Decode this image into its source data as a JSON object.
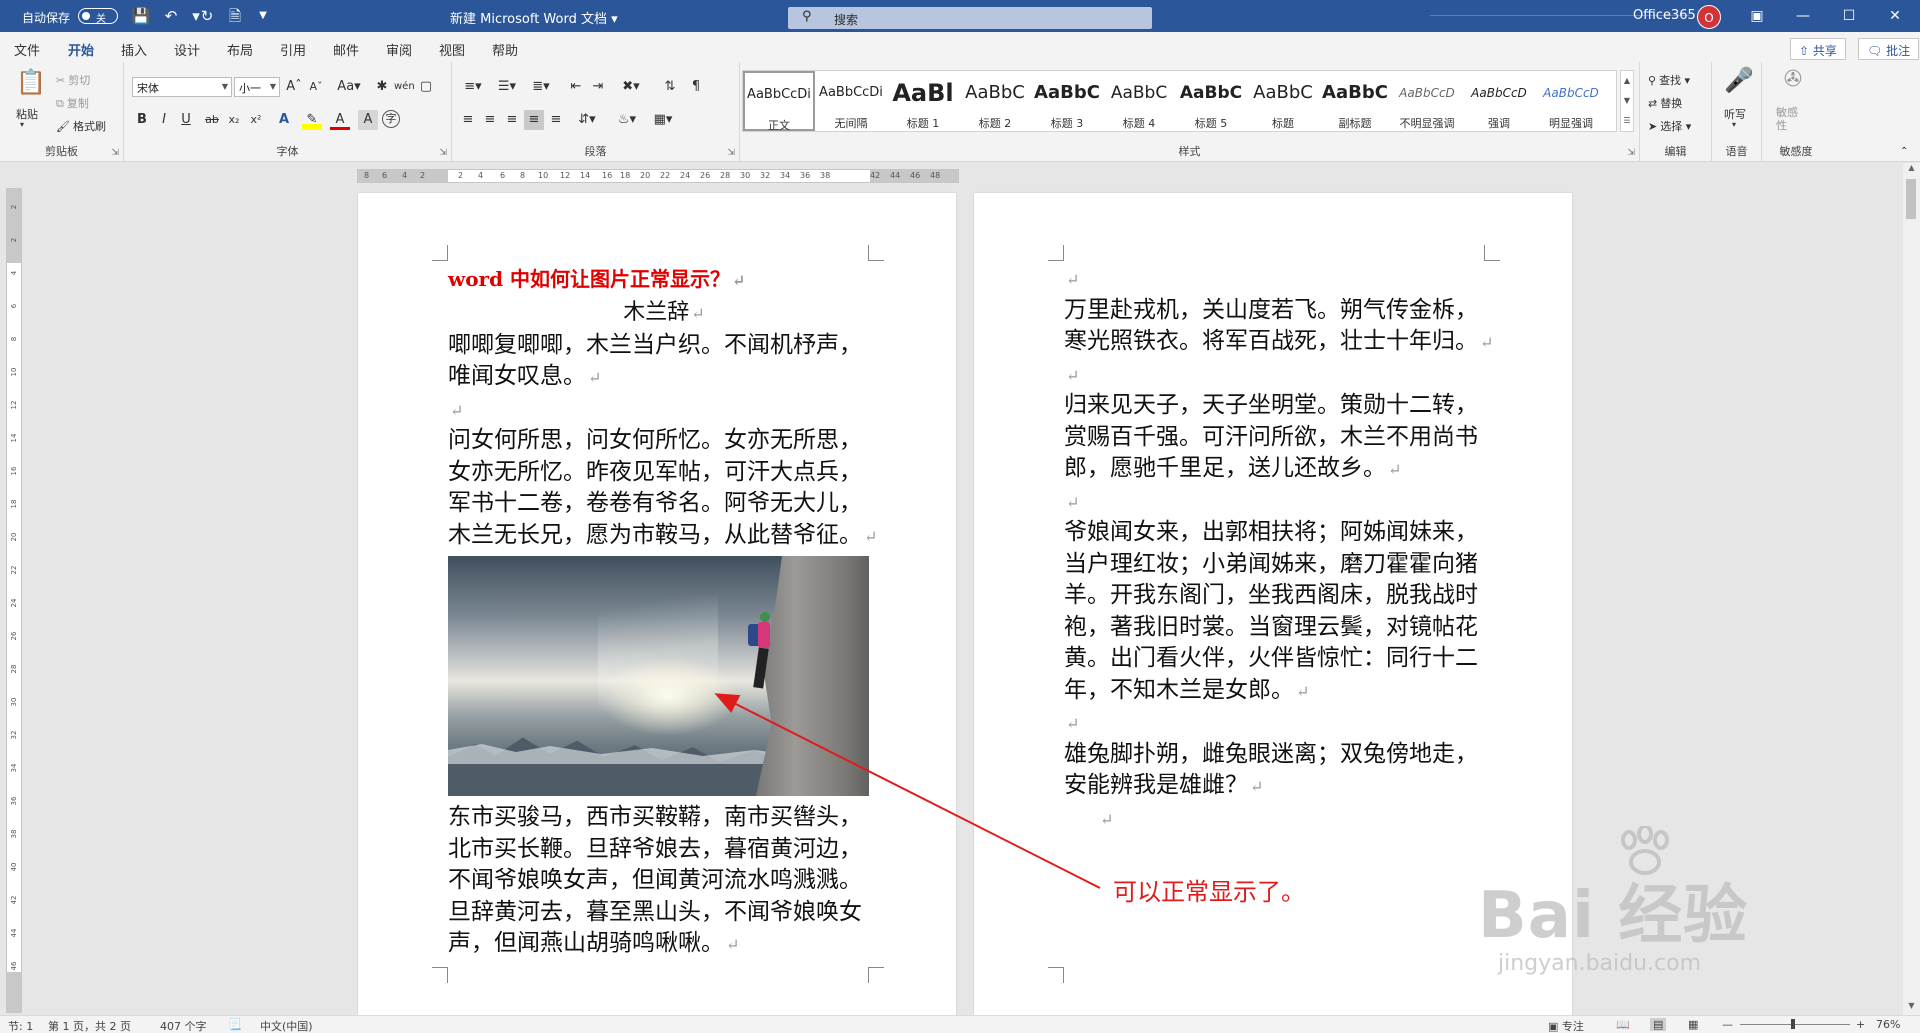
{
  "titlebar": {
    "autosave_label": "自动保存",
    "autosave_state": "关",
    "doc_title": "新建 Microsoft Word 文档",
    "search_placeholder": "搜索",
    "account": "Office365",
    "avatar_initial": "O"
  },
  "tabs": [
    "文件",
    "开始",
    "插入",
    "设计",
    "布局",
    "引用",
    "邮件",
    "审阅",
    "视图",
    "帮助"
  ],
  "active_tab": "开始",
  "share_label": "共享",
  "comment_label": "批注",
  "ribbon": {
    "clipboard": {
      "label": "剪贴板",
      "paste": "粘贴",
      "cut": "剪切",
      "copy": "复制",
      "format_painter": "格式刷"
    },
    "font": {
      "label": "字体",
      "font_name": "宋体",
      "font_size": "小一"
    },
    "paragraph": {
      "label": "段落"
    },
    "styles": {
      "label": "样式",
      "items": [
        {
          "sample": "AaBbCcDi",
          "name": "正文"
        },
        {
          "sample": "AaBbCcDi",
          "name": "无间隔"
        },
        {
          "sample": "AaBl",
          "name": "标题 1"
        },
        {
          "sample": "AaBbC",
          "name": "标题 2"
        },
        {
          "sample": "AaBbC",
          "name": "标题 3"
        },
        {
          "sample": "AaBbC",
          "name": "标题 4"
        },
        {
          "sample": "AaBbC",
          "name": "标题 5"
        },
        {
          "sample": "AaBbC",
          "name": "标题"
        },
        {
          "sample": "AaBbC",
          "name": "副标题"
        },
        {
          "sample": "AaBbCcD",
          "name": "不明显强调"
        },
        {
          "sample": "AaBbCcD",
          "name": "强调"
        },
        {
          "sample": "AaBbCcD",
          "name": "明显强调"
        }
      ]
    },
    "editing": {
      "label": "编辑",
      "find": "查找",
      "replace": "替换",
      "select": "选择"
    },
    "voice": {
      "label": "语音",
      "dictate": "听写"
    },
    "sensitivity": {
      "label": "敏感度",
      "button": "敏感性"
    }
  },
  "ruler_ticks": [
    "8",
    "6",
    "4",
    "2",
    "2",
    "4",
    "6",
    "8",
    "10",
    "12",
    "14",
    "16",
    "18",
    "20",
    "22",
    "24",
    "26",
    "28",
    "30",
    "32",
    "34",
    "36",
    "38",
    "42",
    "44",
    "46",
    "48"
  ],
  "vruler_ticks": [
    "2",
    "2",
    "4",
    "6",
    "8",
    "10",
    "12",
    "14",
    "16",
    "18",
    "20",
    "22",
    "24",
    "26",
    "28",
    "30",
    "32",
    "34",
    "36",
    "38",
    "40",
    "42",
    "44",
    "46"
  ],
  "page1": {
    "title": "word 中如何让图片正常显示？",
    "subtitle": "木兰辞",
    "para1": "唧唧复唧唧，木兰当户织。不闻机杼声，唯闻女叹息。",
    "para2": "问女何所思，问女何所忆。女亦无所思，女亦无所忆。昨夜见军帖，可汗大点兵，军书十二卷，卷卷有爷名。阿爷无大儿，木兰无长兄，愿为市鞍马，从此替爷征。",
    "para3": "东市买骏马，西市买鞍鞯，南市买辔头，北市买长鞭。旦辞爷娘去，暮宿黄河边，不闻爷娘唤女声，但闻黄河流水鸣溅溅。旦辞黄河去，暮至黑山头，不闻爷娘唤女声，但闻燕山胡骑鸣啾啾。"
  },
  "page2": {
    "para1": "万里赴戎机，关山度若飞。朔气传金柝，寒光照铁衣。将军百战死，壮士十年归。",
    "para2": "归来见天子，天子坐明堂。策勋十二转，赏赐百千强。可汗问所欲，木兰不用尚书郎，愿驰千里足，送儿还故乡。",
    "para3": "爷娘闻女来，出郭相扶将；阿姊闻妹来，当户理红妆；小弟闻姊来，磨刀霍霍向猪羊。开我东阁门，坐我西阁床，脱我战时袍，著我旧时裳。当窗理云鬓，对镜帖花黄。出门看火伴，火伴皆惊忙：同行十二年，不知木兰是女郎。",
    "para4": "雄兔脚扑朔，雌兔眼迷离；双兔傍地走，安能辨我是雄雌？"
  },
  "paragraph_mark": "↵",
  "annotation": "可以正常显示了。",
  "watermark": {
    "main": "Bai 经验",
    "sub": "jingyan.baidu.com"
  },
  "status": {
    "section": "节: 1",
    "page": "第 1 页，共 2 页",
    "words": "407 个字",
    "language": "中文(中国)",
    "focus": "专注",
    "zoom": "76%"
  },
  "colors": {
    "accent": "#2b579a",
    "title_red": "#e00000",
    "annotation_red": "#e01b1b"
  }
}
